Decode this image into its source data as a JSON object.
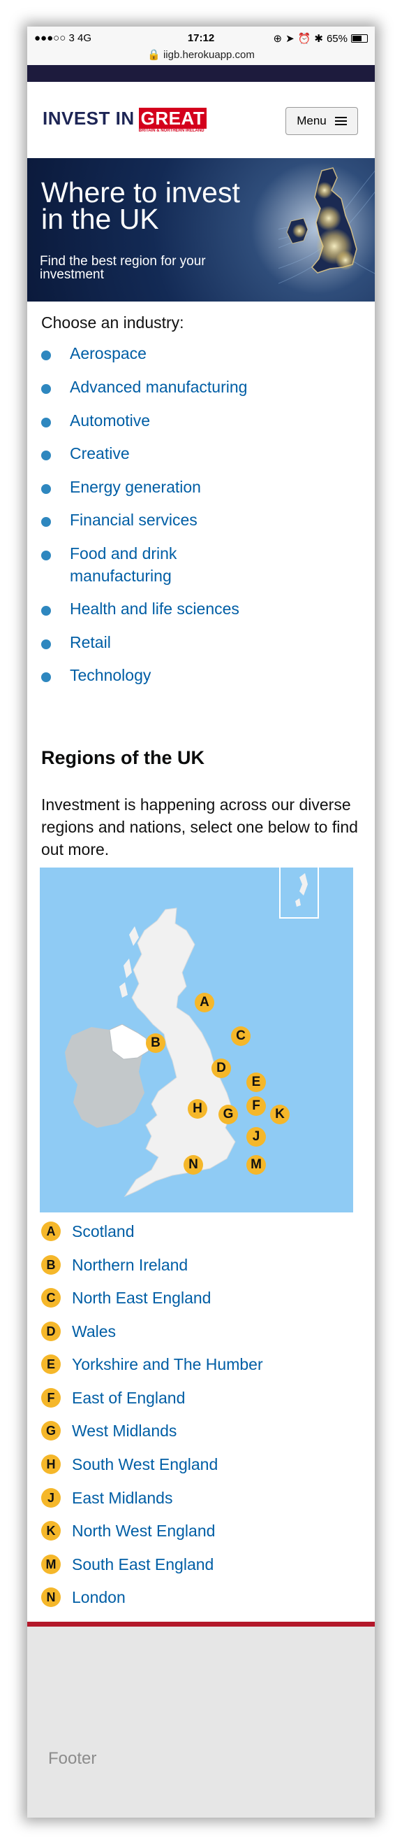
{
  "status_bar": {
    "carrier": "●●●○○ 3   4G",
    "time": "17:12",
    "battery": "65%",
    "url": "iigb.herokuapp.com"
  },
  "header": {
    "logo_invest": "INVEST IN",
    "logo_great": "GREAT",
    "logo_sub": "BRITAIN & NORTHERN IRELAND",
    "menu_label": "Menu"
  },
  "hero": {
    "title_line1": "Where to invest",
    "title_line2": "in the UK",
    "subtitle": "Find the best region for your investment"
  },
  "industries": {
    "heading": "Choose an industry:",
    "items": [
      "Aerospace",
      "Advanced manufacturing",
      "Automotive",
      "Creative",
      "Energy generation",
      "Financial services",
      "Food and drink manufacturing",
      "Health and life sciences",
      "Retail",
      "Technology"
    ]
  },
  "regions": {
    "heading": "Regions of the UK",
    "intro": "Investment is happening across our diverse regions and nations, select one below to find out more.",
    "items": [
      {
        "letter": "A",
        "name": "Scotland"
      },
      {
        "letter": "B",
        "name": "Northern Ireland"
      },
      {
        "letter": "C",
        "name": "North East England"
      },
      {
        "letter": "D",
        "name": "Wales"
      },
      {
        "letter": "E",
        "name": "Yorkshire and The Humber"
      },
      {
        "letter": "F",
        "name": "East of England"
      },
      {
        "letter": "G",
        "name": "West Midlands"
      },
      {
        "letter": "H",
        "name": "South West England"
      },
      {
        "letter": "J",
        "name": "East Midlands"
      },
      {
        "letter": "K",
        "name": "North West England"
      },
      {
        "letter": "M",
        "name": "South East England"
      },
      {
        "letter": "N",
        "name": "London"
      }
    ]
  },
  "colors": {
    "link": "#005ea5",
    "marker": "#f5b72a",
    "brand_red": "#d4001c",
    "navy": "#1d2555",
    "sea": "#8fcbf4"
  },
  "footer": {
    "label": "Footer"
  }
}
